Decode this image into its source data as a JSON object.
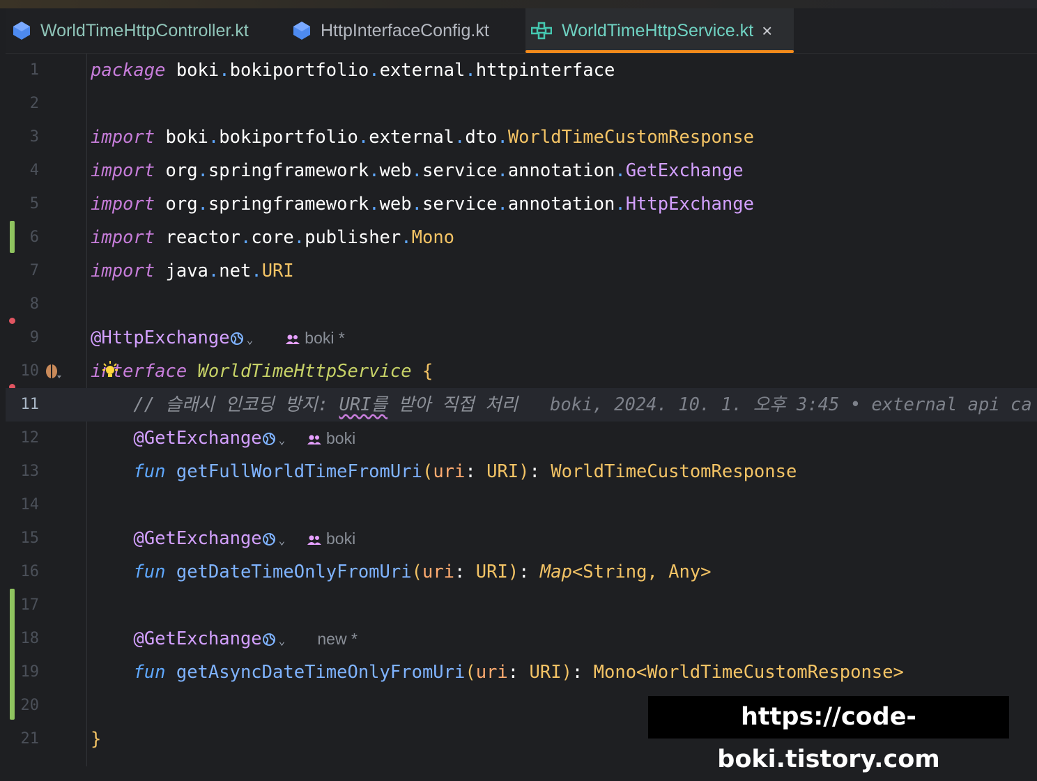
{
  "tabs": [
    {
      "label": "WorldTimeHttpController.kt",
      "active": false
    },
    {
      "label": "HttpInterfaceConfig.kt",
      "active": false
    },
    {
      "label": "WorldTimeHttpService.kt",
      "active": true
    }
  ],
  "close_icon_glyph": "×",
  "line_numbers": [
    "1",
    "2",
    "3",
    "4",
    "5",
    "6",
    "7",
    "8",
    "9",
    "10",
    "11",
    "12",
    "13",
    "14",
    "15",
    "16",
    "17",
    "18",
    "19",
    "20",
    "21"
  ],
  "current_line": 11,
  "code": {
    "l1": {
      "kw": "package",
      "parts": [
        "boki",
        "bokiportfolio",
        "external",
        "httpinterface"
      ]
    },
    "l3": {
      "kw": "import",
      "parts": [
        "boki",
        "bokiportfolio",
        "external",
        "dto"
      ],
      "cls": "WorldTimeCustomResponse"
    },
    "l4": {
      "kw": "import",
      "parts": [
        "org",
        "springframework",
        "web",
        "service",
        "annotation"
      ],
      "cls": "GetExchange"
    },
    "l5": {
      "kw": "import",
      "parts": [
        "org",
        "springframework",
        "web",
        "service",
        "annotation"
      ],
      "cls": "HttpExchange"
    },
    "l6": {
      "kw": "import",
      "parts": [
        "reactor",
        "core",
        "publisher"
      ],
      "cls": "Mono"
    },
    "l7": {
      "kw": "import",
      "parts": [
        "java",
        "net"
      ],
      "cls": "URI"
    },
    "l9": {
      "anno": "@HttpExchange",
      "author": "boki *"
    },
    "l10": {
      "kw": "interface",
      "name": "WorldTimeHttpService",
      "brace": "{"
    },
    "l11": {
      "comment_prefix": "// 슬래시 인코딩 방지: ",
      "comment_uri": "URI를",
      "comment_suffix": " 받아 직접 처리",
      "blame": "boki, 2024. 10. 1. 오후 3:45 • external api ca"
    },
    "l12": {
      "anno": "@GetExchange",
      "author": "boki"
    },
    "l13": {
      "fun": "fun",
      "name": "getFullWorldTimeFromUri",
      "param": "uri",
      "ptype": "URI",
      "ret": "WorldTimeCustomResponse"
    },
    "l15": {
      "anno": "@GetExchange",
      "author": "boki"
    },
    "l16": {
      "fun": "fun",
      "name": "getDateTimeOnlyFromUri",
      "param": "uri",
      "ptype": "URI",
      "ret_map": "Map",
      "ret_generic": "<String, Any>"
    },
    "l18": {
      "anno": "@GetExchange",
      "author": "new *"
    },
    "l19": {
      "fun": "fun",
      "name": "getAsyncDateTimeOnlyFromUri",
      "param": "uri",
      "ptype": "URI",
      "ret": "Mono<WorldTimeCustomResponse>"
    },
    "l21": {
      "brace": "}"
    }
  },
  "watermark": "https://code-boki.tistory.com",
  "colors": {
    "accent_tab_underline": "#f28a1b",
    "change_bar": "#8fc35f",
    "breakpoint_dot": "#e05561"
  }
}
